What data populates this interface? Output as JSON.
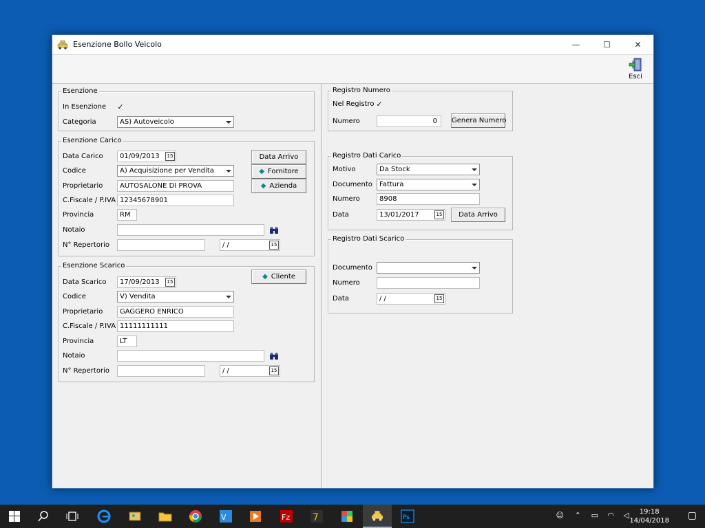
{
  "window": {
    "title": "Esenzione Bollo Veicolo",
    "controls": {
      "minimize": "—",
      "maximize": "☐",
      "close": "✕"
    }
  },
  "toolbar": {
    "exit_label": "Esci",
    "exit_icon": "exit-door-icon"
  },
  "esenzione": {
    "title": "Esenzione",
    "in_esenzione_label": "In Esenzione",
    "in_esenzione_checked": true,
    "categoria_label": "Categoria",
    "categoria_value": "AS) Autoveicolo"
  },
  "carico": {
    "title": "Esenzione Carico",
    "data_label": "Data Carico",
    "data_value": "01/09/2013",
    "codice_label": "Codice",
    "codice_value": "A) Acquisizione per Vendita",
    "proprietario_label": "Proprietario",
    "proprietario_value": "AUTOSALONE DI PROVA",
    "cf_label": "C.Fiscale / P.IVA",
    "cf_value": "12345678901",
    "provincia_label": "Provincia",
    "provincia_value": "RM",
    "notaio_label": "Notaio",
    "notaio_value": "",
    "repertorio_label": "N° Repertorio",
    "repertorio_value": "",
    "repertorio_date": " / /",
    "btn_data_arrivo": "Data Arrivo",
    "btn_fornitore": "Fornitore",
    "btn_azienda": "Azienda"
  },
  "scarico": {
    "title": "Esenzione Scarico",
    "data_label": "Data Scarico",
    "data_value": "17/09/2013",
    "codice_label": "Codice",
    "codice_value": "V) Vendita",
    "proprietario_label": "Proprietario",
    "proprietario_value": "GAGGERO ENRICO",
    "cf_label": "C.Fiscale / P.IVA",
    "cf_value": "11111111111",
    "provincia_label": "Provincia",
    "provincia_value": "LT",
    "notaio_label": "Notaio",
    "notaio_value": "",
    "repertorio_label": "N° Repertorio",
    "repertorio_value": "",
    "repertorio_date": " / /",
    "btn_cliente": "Cliente"
  },
  "registro_numero": {
    "title": "Registro Numero",
    "nel_registro_label": "Nel Registro",
    "nel_registro_checked": true,
    "numero_label": "Numero",
    "numero_value": "0",
    "btn_genera": "Genera Numero"
  },
  "registro_carico": {
    "title": "Registro Dati Carico",
    "motivo_label": "Motivo",
    "motivo_value": "Da Stock",
    "documento_label": "Documento",
    "documento_value": "Fattura",
    "numero_label": "Numero",
    "numero_value": "8908",
    "data_label": "Data",
    "data_value": "13/01/2017",
    "btn_data_arrivo": "Data Arrivo"
  },
  "registro_scarico": {
    "title": "Registro Dati Scarico",
    "documento_label": "Documento",
    "documento_value": "",
    "numero_label": "Numero",
    "numero_value": "",
    "data_label": "Data",
    "data_value": " / /"
  },
  "calendar_glyph": "15",
  "checkmark_glyph": "✓",
  "taskbar": {
    "time": "19:18",
    "date": "14/04/2018",
    "apps": [
      "start-icon",
      "search-icon",
      "task-view-icon",
      "edge-icon",
      "photo-app-icon",
      "file-explorer-icon",
      "chrome-icon",
      "vs-icon",
      "media-player-icon",
      "filezilla-icon",
      "7zip-icon",
      "office-app-icon",
      "bollo-app-icon",
      "photoshop-icon"
    ]
  }
}
